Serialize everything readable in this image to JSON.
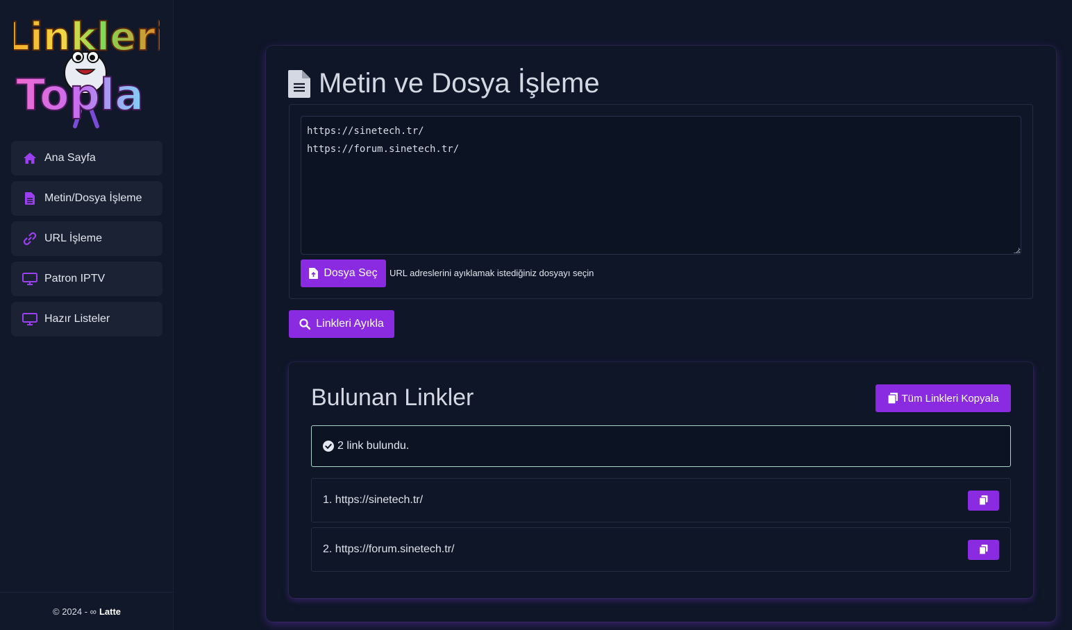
{
  "logo": {
    "line1": "Linkleri",
    "line2": "Topla"
  },
  "sidebar": {
    "items": [
      {
        "label": "Ana Sayfa",
        "icon": "home-icon"
      },
      {
        "label": "Metin/Dosya İşleme",
        "icon": "file-icon"
      },
      {
        "label": "URL İşleme",
        "icon": "link-icon"
      },
      {
        "label": "Patron IPTV",
        "icon": "monitor-icon"
      },
      {
        "label": "Hazır Listeler",
        "icon": "monitor-icon"
      }
    ],
    "footer": {
      "copyright": "© 2024 - ∞",
      "brand": "Latte"
    }
  },
  "main": {
    "title": "Metin ve Dosya İşleme",
    "textarea_value": "https://sinetech.tr/\nhttps://forum.sinetech.tr/",
    "file_button": "Dosya Seç",
    "file_hint": "URL adreslerini ayıklamak istediğiniz dosyayı seçin",
    "extract_button": "Linkleri Ayıkla"
  },
  "results": {
    "title": "Bulunan Linkler",
    "copy_all_button": "Tüm Linkleri Kopyala",
    "alert": "2 link bulundu.",
    "links": [
      {
        "text": "1. https://sinetech.tr/"
      },
      {
        "text": "2. https://forum.sinetech.tr/"
      }
    ]
  },
  "colors": {
    "accent": "#8a2be2",
    "background": "#0e1627",
    "sidebar_item": "#1a2233"
  }
}
